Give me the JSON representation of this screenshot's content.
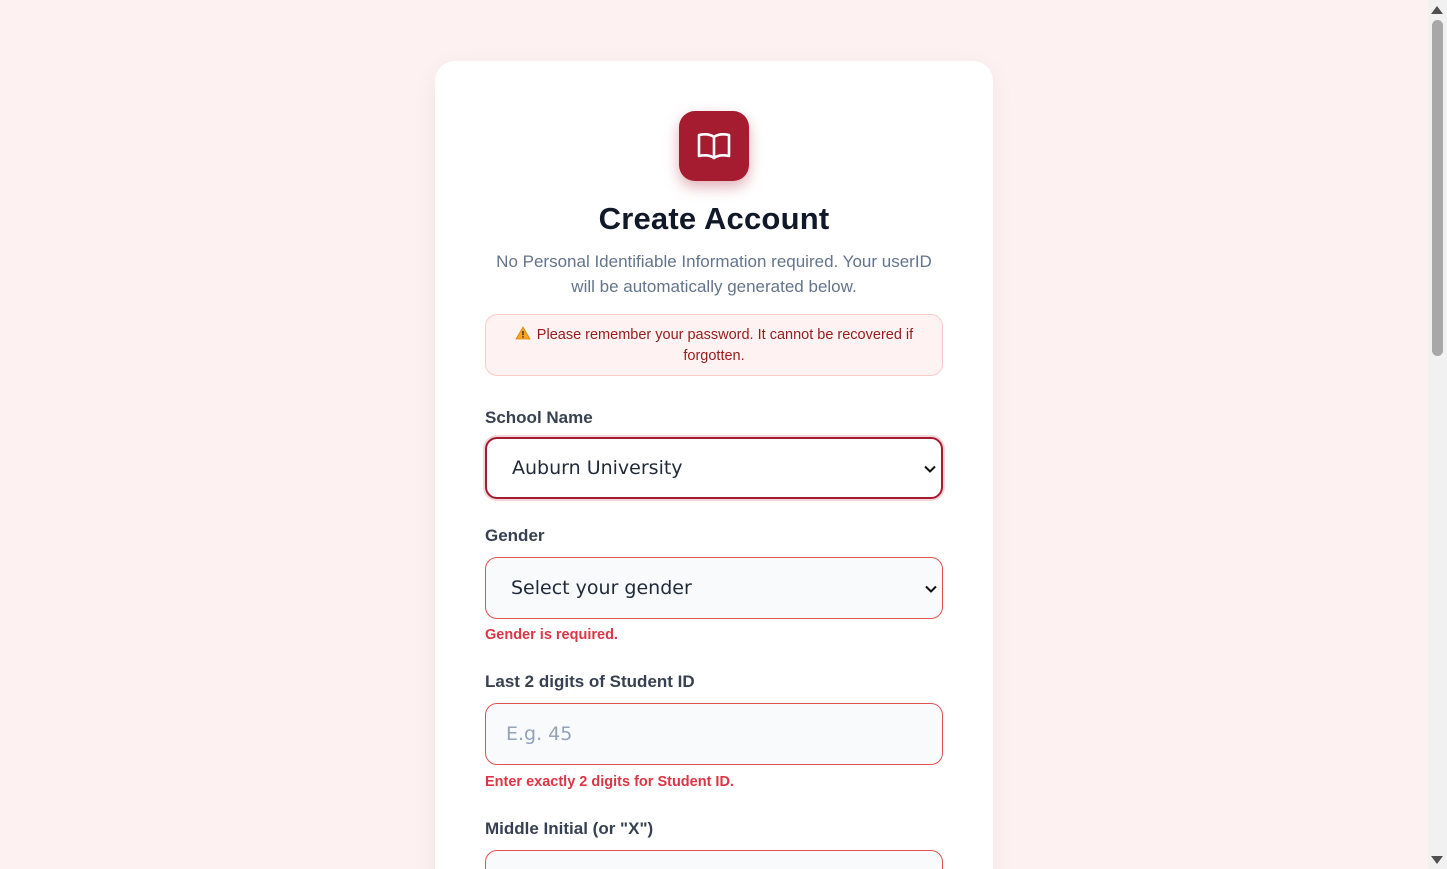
{
  "header": {
    "title": "Create Account",
    "subtitle": "No Personal Identifiable Information required. Your userID will be automatically generated below."
  },
  "alert": {
    "icon": "warning-icon",
    "text": "Please remember your password. It cannot be recovered if forgotten."
  },
  "form": {
    "school": {
      "label": "School Name",
      "value": "Auburn University"
    },
    "gender": {
      "label": "Gender",
      "value": "Select your gender",
      "error": "Gender is required."
    },
    "student_id": {
      "label": "Last 2 digits of Student ID",
      "placeholder": "E.g. 45",
      "error": "Enter exactly 2 digits for Student ID."
    },
    "middle_initial": {
      "label": "Middle Initial (or \"X\")"
    }
  },
  "colors": {
    "accent": "#a51c30",
    "error": "#dc3545",
    "background": "#fef1f1"
  }
}
